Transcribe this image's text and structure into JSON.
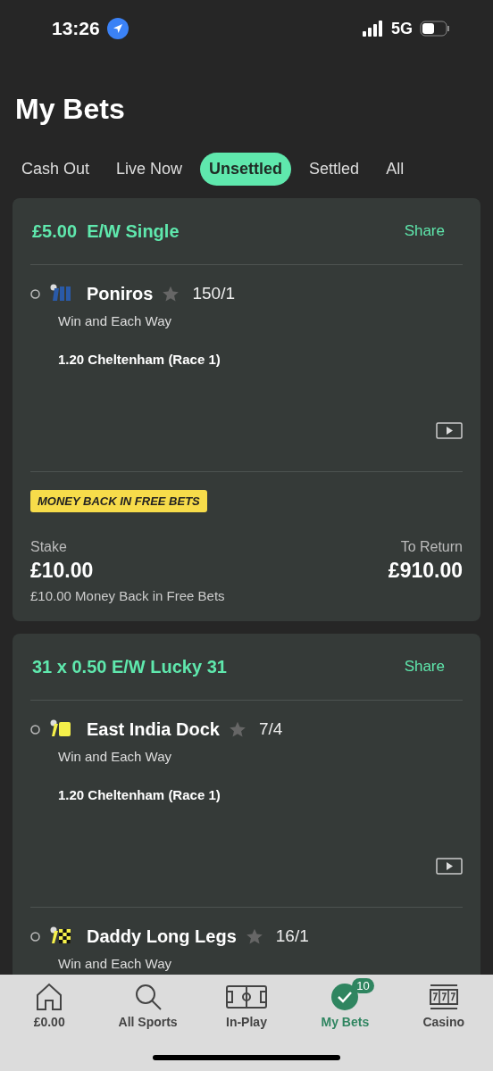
{
  "status_bar": {
    "time": "13:26",
    "network": "5G"
  },
  "title": "My Bets",
  "tabs": [
    {
      "label": "Cash Out",
      "selected": false
    },
    {
      "label": "Live Now",
      "selected": false
    },
    {
      "label": "Unsettled",
      "selected": true
    },
    {
      "label": "Settled",
      "selected": false
    },
    {
      "label": "All",
      "selected": false
    }
  ],
  "bets": [
    {
      "title": "£5.00  E/W Single",
      "share": "Share",
      "selections": [
        {
          "kind": "stripes",
          "color": "#2a5aa8",
          "name": "Poniros",
          "favourite": false,
          "odds": "150/1",
          "market": "Win and Each Way",
          "event": "1.20 Cheltenham (Race 1)"
        }
      ],
      "promo": "MONEY BACK IN FREE BETS",
      "stake_label": "Stake",
      "stake": "£10.00",
      "stake_note": "£10.00 Money Back in Free Bets",
      "return_label": "To Return",
      "return": "£910.00"
    },
    {
      "title": "31 x 0.50 E/W Lucky 31",
      "share": "Share",
      "selections": [
        {
          "kind": "plain",
          "color": "#f5f04a",
          "name": "East India Dock",
          "favourite": false,
          "odds": "7/4",
          "market": "Win and Each Way",
          "event": "1.20 Cheltenham (Race 1)"
        },
        {
          "kind": "checks",
          "color": "#f5f04a",
          "name": "Daddy Long Legs",
          "favourite": false,
          "odds": "16/1",
          "market": "Win and Each Way"
        }
      ]
    }
  ],
  "nav": [
    {
      "label": "£0.00",
      "selected": false
    },
    {
      "label": "All Sports",
      "selected": false
    },
    {
      "label": "In-Play",
      "selected": false
    },
    {
      "label": "My Bets",
      "selected": true,
      "badge": "10"
    },
    {
      "label": "Casino",
      "selected": false
    }
  ]
}
